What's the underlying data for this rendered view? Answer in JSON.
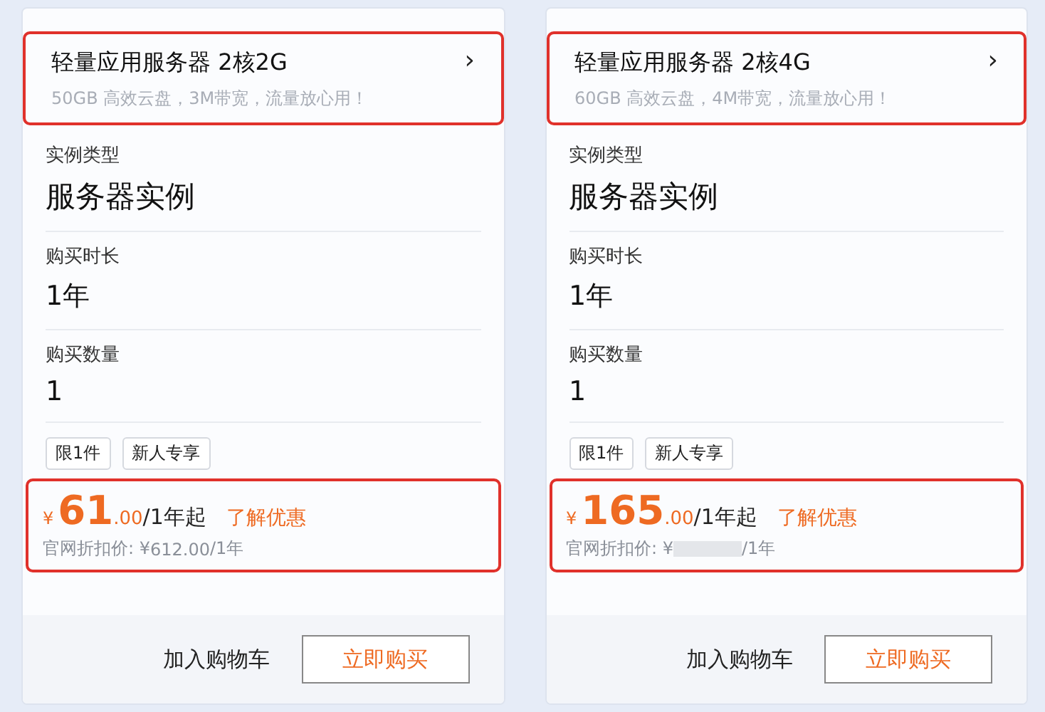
{
  "cards": [
    {
      "title": "轻量应用服务器 2核2G",
      "chevron": "›",
      "subtitle": "50GB 高效云盘，3M带宽，流量放心用！",
      "header_highlighted": true,
      "fields": [
        {
          "label": "实例类型",
          "value": "服务器实例"
        },
        {
          "label": "购买时长",
          "value": "1年"
        },
        {
          "label": "购买数量",
          "value": "1"
        }
      ],
      "tags": [
        "限1件",
        "新人专享"
      ],
      "price": {
        "currency": "¥",
        "integer": "61",
        "decimal": ".00",
        "unit": "/1年起",
        "link": "了解优惠",
        "highlighted": true,
        "list_prefix": "官网折扣价: ¥",
        "list_amount": "612.00",
        "list_redacted": false,
        "list_suffix": "/1年"
      },
      "cart_button": "加入购物车",
      "buy_button": "立即购买"
    },
    {
      "title": "轻量应用服务器 2核4G",
      "chevron": "›",
      "subtitle": "60GB 高效云盘，4M带宽，流量放心用！",
      "header_highlighted": true,
      "fields": [
        {
          "label": "实例类型",
          "value": "服务器实例"
        },
        {
          "label": "购买时长",
          "value": "1年"
        },
        {
          "label": "购买数量",
          "value": "1"
        }
      ],
      "tags": [
        "限1件",
        "新人专享"
      ],
      "price": {
        "currency": "¥",
        "integer": "165",
        "decimal": ".00",
        "unit": "/1年起",
        "link": "了解优惠",
        "highlighted": true,
        "list_prefix": "官网折扣价: ¥",
        "list_redacted": true,
        "list_suffix": "/1年"
      },
      "cart_button": "加入购物车",
      "buy_button": "立即购买"
    }
  ]
}
